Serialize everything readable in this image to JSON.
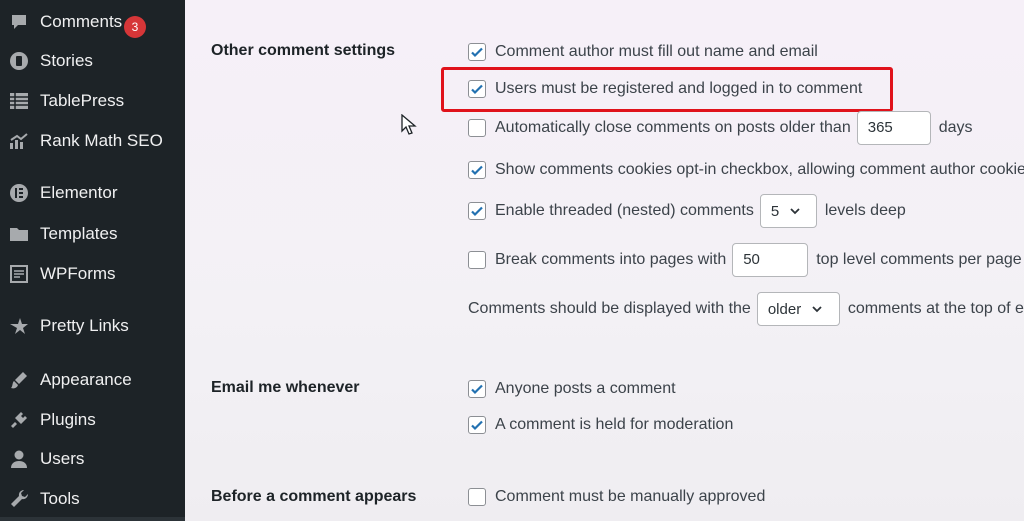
{
  "sidebar": {
    "items": [
      {
        "label": "Comments",
        "icon": "comment-bubble-icon",
        "badge": "3"
      },
      {
        "label": "Stories",
        "icon": "stories-icon"
      },
      {
        "label": "TablePress",
        "icon": "table-icon"
      },
      {
        "label": "Rank Math SEO",
        "icon": "chart-icon"
      },
      {
        "label": "Elementor",
        "icon": "elementor-icon"
      },
      {
        "label": "Templates",
        "icon": "folder-icon"
      },
      {
        "label": "WPForms",
        "icon": "forms-icon"
      },
      {
        "label": "Pretty Links",
        "icon": "star-link-icon"
      },
      {
        "label": "Appearance",
        "icon": "paintbrush-icon"
      },
      {
        "label": "Plugins",
        "icon": "plug-icon"
      },
      {
        "label": "Users",
        "icon": "user-icon"
      },
      {
        "label": "Tools",
        "icon": "wrench-icon"
      }
    ]
  },
  "sections": {
    "other": {
      "title": "Other comment settings",
      "author_fill": {
        "label": "Comment author must fill out name and email",
        "checked": true
      },
      "registered": {
        "label": "Users must be registered and logged in to comment",
        "checked": true
      },
      "auto_close": {
        "label": "Automatically close comments on posts older than",
        "checked": false,
        "value": "365",
        "suffix": "days"
      },
      "cookies": {
        "label": "Show comments cookies opt-in checkbox, allowing comment author cookies",
        "checked": true
      },
      "threaded": {
        "label": "Enable threaded (nested) comments",
        "checked": true,
        "value": "5",
        "suffix": "levels deep"
      },
      "paging": {
        "label": "Break comments into pages with",
        "checked": false,
        "value": "50",
        "suffix": "top level comments per page"
      },
      "display": {
        "prefix": "Comments should be displayed with the",
        "value": "older",
        "suffix": "comments at the top of each page"
      }
    },
    "email": {
      "title": "Email me whenever",
      "anyone": {
        "label": "Anyone posts a comment",
        "checked": true
      },
      "held": {
        "label": "A comment is held for moderation",
        "checked": true
      }
    },
    "before": {
      "title": "Before a comment appears",
      "manual": {
        "label": "Comment must be manually approved",
        "checked": false
      }
    }
  },
  "colors": {
    "sidebar_bg": "#1d2327",
    "check_blue": "#2271b1",
    "highlight_red": "#e0121b",
    "badge_red": "#d63638"
  }
}
